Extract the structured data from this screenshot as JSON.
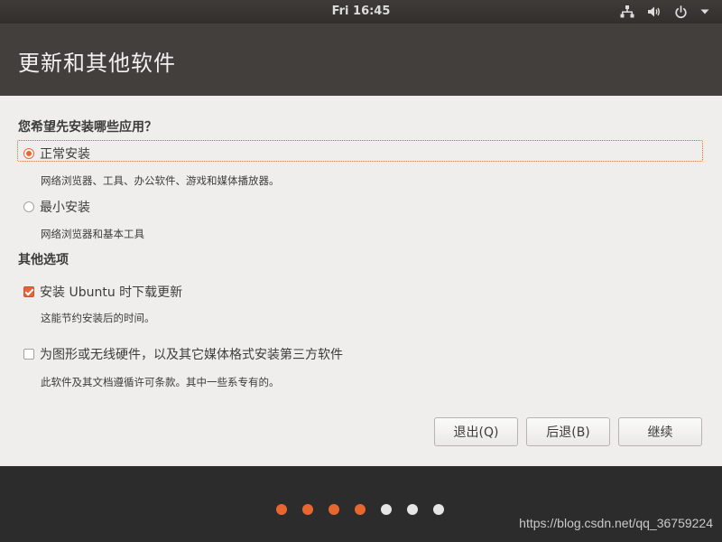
{
  "top_bar": {
    "clock": "Fri 16:45",
    "icons": [
      "network-icon",
      "volume-icon",
      "power-icon",
      "chevron-down-icon"
    ]
  },
  "header": {
    "title": "更新和其他软件"
  },
  "install_type": {
    "heading": "您希望先安装哪些应用？",
    "options": [
      {
        "label": "正常安装",
        "description": "网络浏览器、工具、办公软件、游戏和媒体播放器。",
        "selected": true
      },
      {
        "label": "最小安装",
        "description": "网络浏览器和基本工具",
        "selected": false
      }
    ]
  },
  "other_options": {
    "heading": "其他选项",
    "items": [
      {
        "label": "安装 Ubuntu 时下载更新",
        "description": "这能节约安装后的时间。",
        "checked": true
      },
      {
        "label": "为图形或无线硬件，以及其它媒体格式安装第三方软件",
        "description": "此软件及其文档遵循许可条款。其中一些系专有的。",
        "checked": false
      }
    ]
  },
  "buttons": {
    "quit": "退出(Q)",
    "back": "后退(B)",
    "continue": "继续"
  },
  "progress": {
    "total_steps": 7,
    "completed_steps": 4,
    "active_color": "#e9672f",
    "inactive_color": "#e6e6e6"
  },
  "watermark": "https://blog.csdn.net/qq_36759224",
  "colors": {
    "accent": "#e9672f",
    "header_bg": "#433f3c",
    "content_bg": "#efeeec"
  }
}
